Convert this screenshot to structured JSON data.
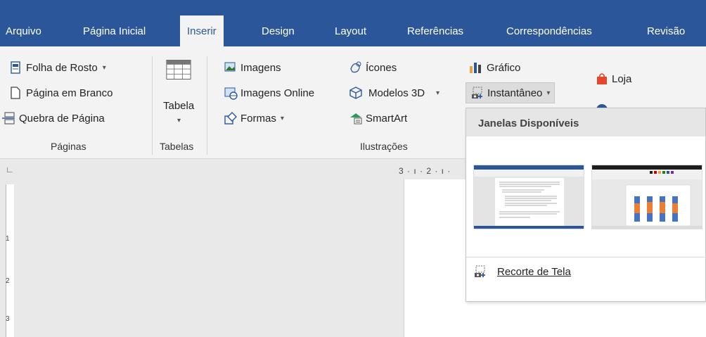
{
  "tabs": [
    {
      "label": "Arquivo",
      "active": false
    },
    {
      "label": "Página Inicial",
      "active": false
    },
    {
      "label": "Inserir",
      "active": true
    },
    {
      "label": "Design",
      "active": false
    },
    {
      "label": "Layout",
      "active": false
    },
    {
      "label": "Referências",
      "active": false
    },
    {
      "label": "Correspondências",
      "active": false
    },
    {
      "label": "Revisão",
      "active": false
    }
  ],
  "ribbon": {
    "paginas": {
      "items": [
        "Folha de Rosto",
        "Página em Branco",
        "Quebra de Página"
      ],
      "label": "Páginas"
    },
    "tabelas": {
      "button": "Tabela",
      "label": "Tabelas"
    },
    "ilustracoes": {
      "items": [
        "Imagens",
        "Imagens Online",
        "Formas",
        "Ícones",
        "Modelos 3D",
        "SmartArt",
        "Gráfico",
        "Instantâneo"
      ],
      "label": "Ilustrações"
    },
    "loja": "Loja"
  },
  "ruler": {
    "top_text": "3 · ı · 2 · ı ·"
  },
  "dropdown": {
    "header": "Janelas Disponíveis",
    "clip_label": "Recorte de Tela"
  },
  "colors": {
    "accent": "#2b579a",
    "ribbon_bg": "#f3f3f3"
  }
}
